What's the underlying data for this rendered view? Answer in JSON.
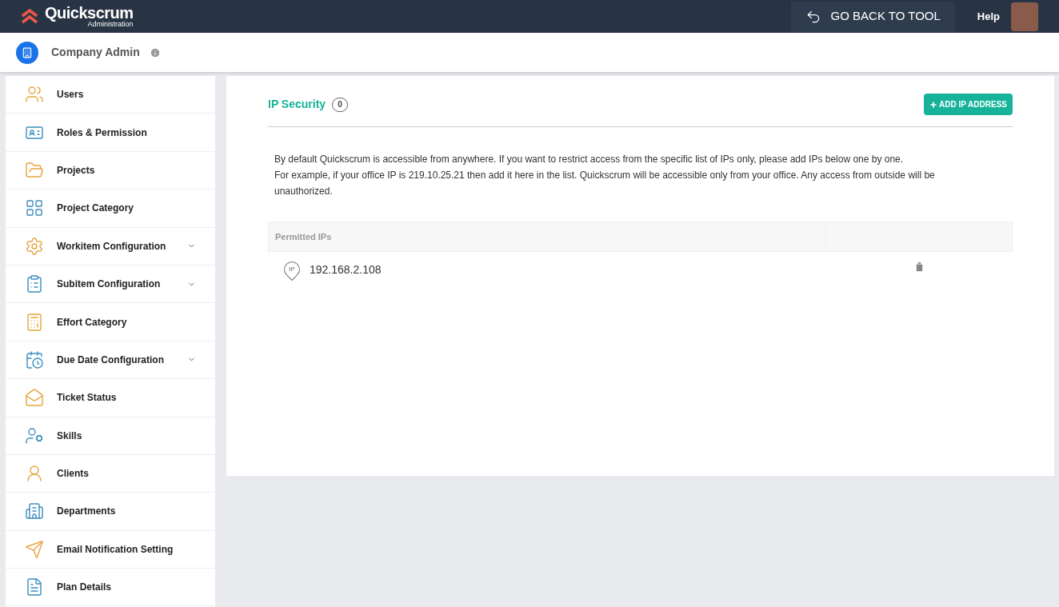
{
  "header": {
    "logo": "Quickscrum",
    "logo_sub": "Administration",
    "back_button": "GO BACK TO TOOL",
    "help": "Help"
  },
  "company": {
    "name": "Company Admin"
  },
  "sidebar": {
    "items": [
      {
        "label": "Users",
        "expandable": false
      },
      {
        "label": "Roles & Permission",
        "expandable": false
      },
      {
        "label": "Projects",
        "expandable": false
      },
      {
        "label": "Project Category",
        "expandable": false
      },
      {
        "label": "Workitem Configuration",
        "expandable": true
      },
      {
        "label": "Subitem Configuration",
        "expandable": true
      },
      {
        "label": "Effort Category",
        "expandable": false
      },
      {
        "label": "Due Date Configuration",
        "expandable": true
      },
      {
        "label": "Ticket Status",
        "expandable": false
      },
      {
        "label": "Skills",
        "expandable": false
      },
      {
        "label": "Clients",
        "expandable": false
      },
      {
        "label": "Departments",
        "expandable": false
      },
      {
        "label": "Email Notification Setting",
        "expandable": false
      },
      {
        "label": "Plan Details",
        "expandable": false
      }
    ]
  },
  "main": {
    "title": "IP Security",
    "count": "0",
    "add_button": "ADD IP ADDRESS",
    "description": [
      "By default Quickscrum is accessible from anywhere. If you want to restrict access from the specific list of IPs only, please add IPs below one by one.",
      "For example, if your office IP is 219.10.25.21 then add it here in the list. Quickscrum will be accessible only from your office. Any access from outside will be unauthorized."
    ],
    "table": {
      "columns": [
        "Permitted IPs"
      ],
      "rows": [
        {
          "badge": "IP",
          "address": "192.168.2.108"
        }
      ]
    }
  }
}
